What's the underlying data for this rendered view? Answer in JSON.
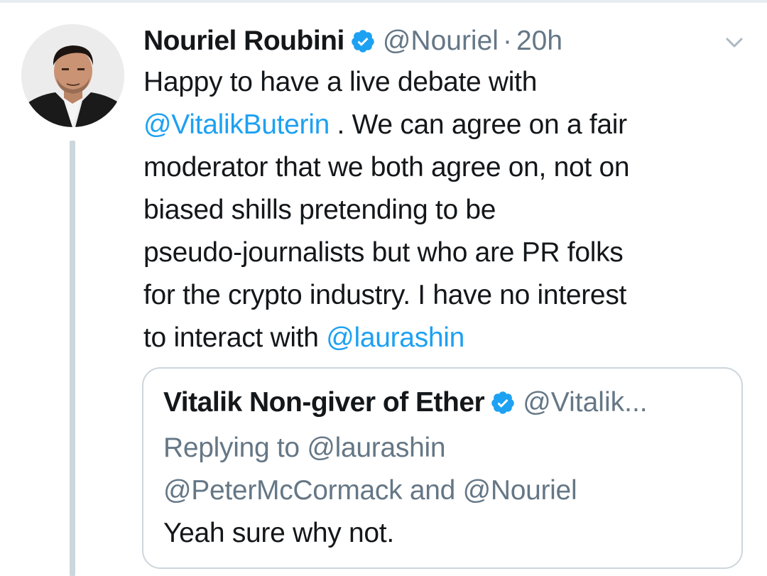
{
  "tweet": {
    "author_name": "Nouriel Roubini",
    "handle": "@Nouriel",
    "separator": "·",
    "time": "20h",
    "avatar_icon": "profile-photo",
    "verified_icon": "verified-badge-icon",
    "menu_icon": "chevron-down-icon",
    "text_lines": [
      {
        "pre": "Happy to have a live debate with",
        "mention": "",
        "post": ""
      },
      {
        "pre": "",
        "mention": "@VitalikButerin",
        "post": " . We can agree on a fair"
      },
      {
        "pre": "moderator that we both agree on, not on",
        "mention": "",
        "post": ""
      },
      {
        "pre": "biased shills pretending to be",
        "mention": "",
        "post": ""
      },
      {
        "pre": "pseudo-journalists but who are PR folks",
        "mention": "",
        "post": ""
      },
      {
        "pre": "for the crypto industry. I have no interest",
        "mention": "",
        "post": ""
      },
      {
        "pre": "to interact with ",
        "mention": "@laurashin",
        "post": ""
      }
    ]
  },
  "quoted_tweet": {
    "author_name": "Vitalik Non-giver of Ether",
    "handle": "@Vitalik...",
    "reply_line_1": {
      "pre": "Replying to ",
      "mention": "@laurashin"
    },
    "reply_line_2": {
      "mention_1": "@PeterMcCormack",
      "mid": " and ",
      "mention_2": "@Nouriel"
    },
    "text": "Yeah sure why not."
  },
  "colors": {
    "link": "#1da1f2",
    "secondary_text": "#657786",
    "primary_text": "#14171a",
    "border": "#ccd6dd",
    "verified": "#1da1f2"
  }
}
